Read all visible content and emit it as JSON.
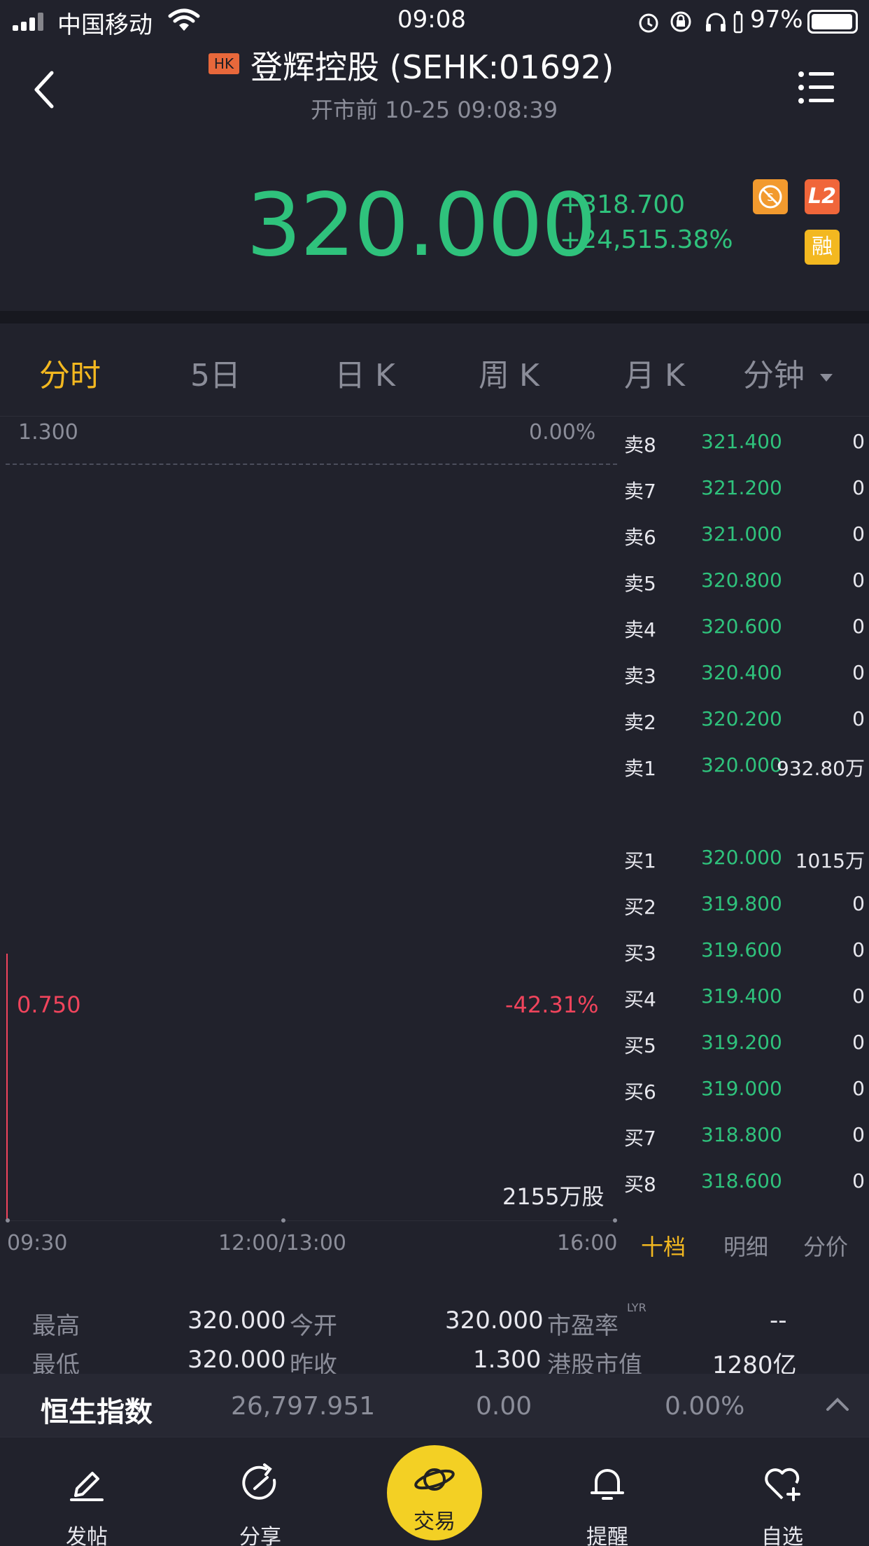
{
  "status_bar": {
    "carrier": "中国移动",
    "time": "09:08",
    "battery": "97%"
  },
  "header": {
    "market_badge": "HK",
    "title": "登辉控股 (SEHK:01692)",
    "subtitle": "开市前 10-25 09:08:39"
  },
  "quote": {
    "price": "320.000",
    "change": "+318.700",
    "change_pct": "+24,515.38%",
    "badge_l2": "L2",
    "badge_margin": "融",
    "colors": {
      "up": "#2fc27c",
      "down": "#f0445c",
      "accent": "#f3b820"
    }
  },
  "tabs": [
    {
      "label": "分时"
    },
    {
      "label": "5日"
    },
    {
      "label": "日 K"
    },
    {
      "label": "周 K"
    },
    {
      "label": "月 K"
    },
    {
      "label": "分钟"
    }
  ],
  "chart": {
    "y_top_label": "1.300",
    "pct_top_label": "0.00%",
    "y_mid_label": "0.750",
    "pct_mid_label": "-42.31%",
    "volume_label": "2155万股",
    "x_labels": [
      "09:30",
      "12:00/13:00",
      "16:00"
    ]
  },
  "order_book": {
    "asks": [
      {
        "label": "卖8",
        "price": "321.400",
        "qty": "0"
      },
      {
        "label": "卖7",
        "price": "321.200",
        "qty": "0"
      },
      {
        "label": "卖6",
        "price": "321.000",
        "qty": "0"
      },
      {
        "label": "卖5",
        "price": "320.800",
        "qty": "0"
      },
      {
        "label": "卖4",
        "price": "320.600",
        "qty": "0"
      },
      {
        "label": "卖3",
        "price": "320.400",
        "qty": "0"
      },
      {
        "label": "卖2",
        "price": "320.200",
        "qty": "0"
      },
      {
        "label": "卖1",
        "price": "320.000",
        "qty": "932.80万"
      }
    ],
    "bids": [
      {
        "label": "买1",
        "price": "320.000",
        "qty": "1015万"
      },
      {
        "label": "买2",
        "price": "319.800",
        "qty": "0"
      },
      {
        "label": "买3",
        "price": "319.600",
        "qty": "0"
      },
      {
        "label": "买4",
        "price": "319.400",
        "qty": "0"
      },
      {
        "label": "买5",
        "price": "319.200",
        "qty": "0"
      },
      {
        "label": "买6",
        "price": "319.000",
        "qty": "0"
      },
      {
        "label": "买7",
        "price": "318.800",
        "qty": "0"
      },
      {
        "label": "买8",
        "price": "318.600",
        "qty": "0"
      }
    ],
    "tabs": [
      "十档",
      "明细",
      "分价"
    ]
  },
  "stats": {
    "high_label": "最高",
    "high": "320.000",
    "open_label": "今开",
    "open": "320.000",
    "pe_label": "市盈率",
    "pe_sup": "LYR",
    "pe": "--",
    "low_label": "最低",
    "low": "320.000",
    "prev_close_label": "昨收",
    "prev_close": "1.300",
    "mktcap_label": "港股市值",
    "mktcap": "1280亿"
  },
  "index_bar": {
    "name": "恒生指数",
    "value": "26,797.951",
    "change": "0.00",
    "change_pct": "0.00%"
  },
  "bottom_nav": [
    {
      "label": "发帖",
      "icon": "pen-icon"
    },
    {
      "label": "分享",
      "icon": "share-icon"
    },
    {
      "label": "交易",
      "icon": "planet-icon"
    },
    {
      "label": "提醒",
      "icon": "bell-icon"
    },
    {
      "label": "自选",
      "icon": "heart-plus-icon"
    }
  ]
}
